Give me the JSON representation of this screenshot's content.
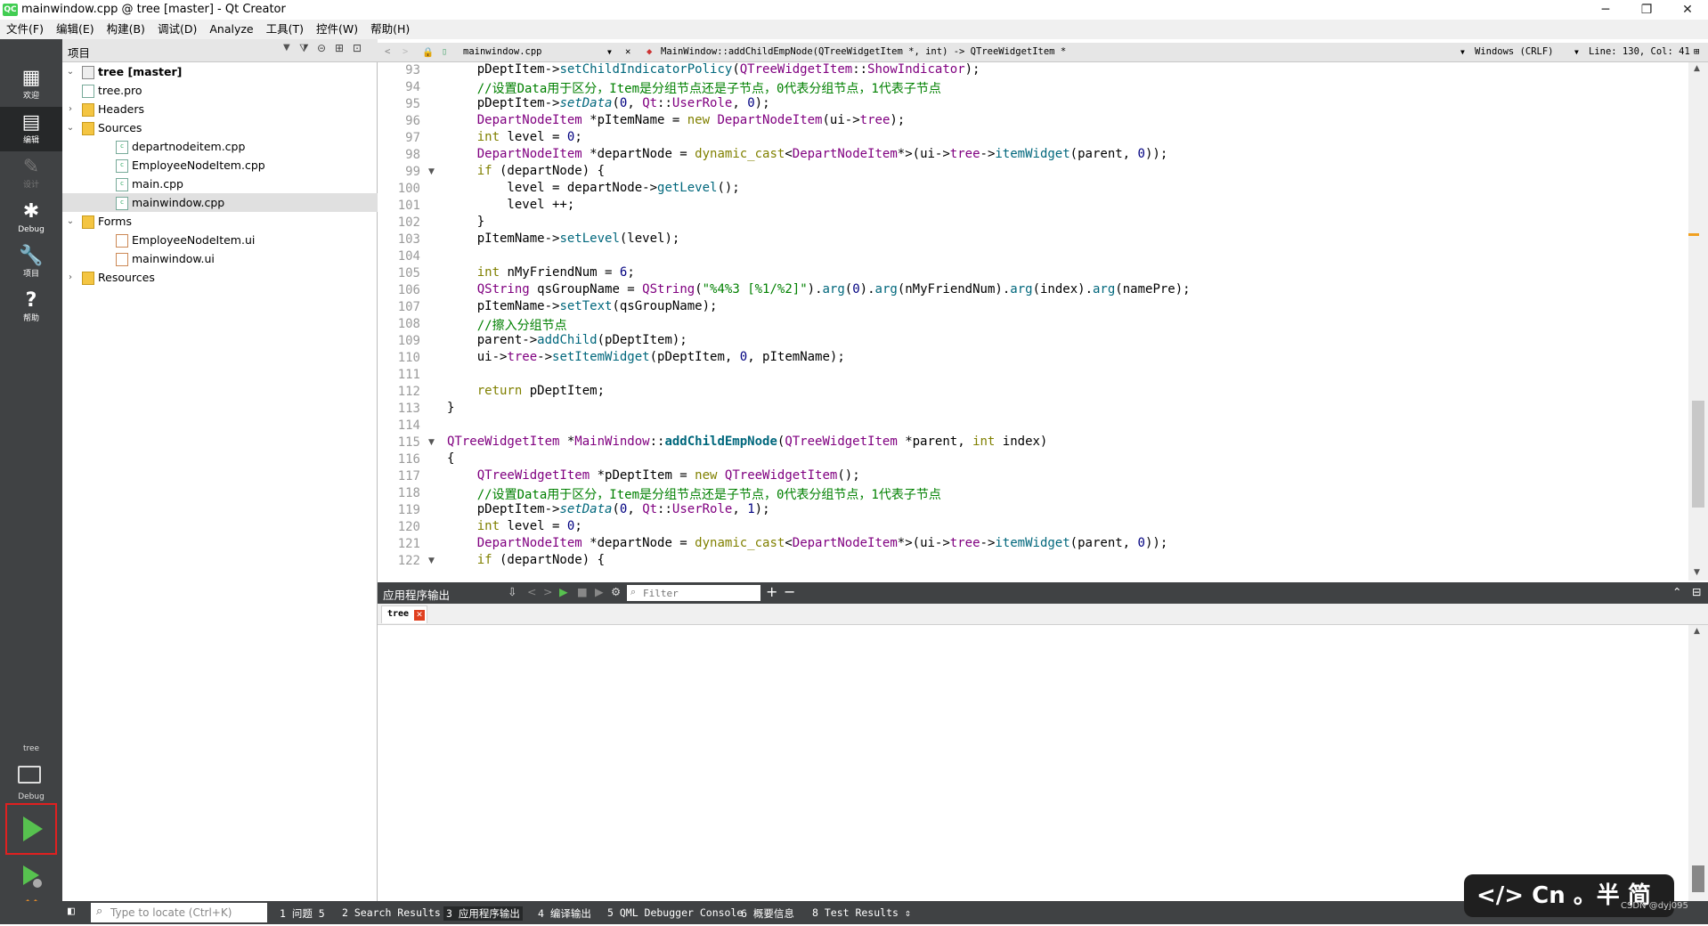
{
  "window": {
    "title": "mainwindow.cpp @ tree [master] - Qt Creator",
    "logo": "QC"
  },
  "window_buttons": {
    "minimize": "─",
    "maximize": "❐",
    "close": "✕"
  },
  "menu": [
    "文件(F)",
    "编辑(E)",
    "构建(B)",
    "调试(D)",
    "Analyze",
    "工具(T)",
    "控件(W)",
    "帮助(H)"
  ],
  "modes": [
    {
      "label": "欢迎",
      "icon": "▦"
    },
    {
      "label": "编辑",
      "icon": "▤"
    },
    {
      "label": "设计",
      "icon": "✎"
    },
    {
      "label": "Debug",
      "icon": "✱"
    },
    {
      "label": "项目",
      "icon": "🔧"
    },
    {
      "label": "帮助",
      "icon": "?"
    }
  ],
  "kit": {
    "project": "tree",
    "config": "Debug"
  },
  "project_panel": {
    "title": "项目"
  },
  "tree": [
    {
      "label": "tree [master]",
      "arrow": "⌄",
      "icon": "proj"
    },
    {
      "label": "tree.pro",
      "icon": "file"
    },
    {
      "label": "Headers",
      "arrow": "›",
      "icon": "folder"
    },
    {
      "label": "Sources",
      "arrow": "⌄",
      "icon": "folder"
    },
    {
      "label": "departnodeitem.cpp",
      "icon": "cpp"
    },
    {
      "label": "EmployeeNodeItem.cpp",
      "icon": "cpp"
    },
    {
      "label": "main.cpp",
      "icon": "cpp"
    },
    {
      "label": "mainwindow.cpp",
      "icon": "cpp",
      "selected": true
    },
    {
      "label": "Forms",
      "arrow": "⌄",
      "icon": "folder"
    },
    {
      "label": "EmployeeNodeItem.ui",
      "icon": "ui"
    },
    {
      "label": "mainwindow.ui",
      "icon": "ui"
    },
    {
      "label": "Resources",
      "arrow": "›",
      "icon": "folder"
    }
  ],
  "editor": {
    "file_tab": "mainwindow.cpp",
    "function": "MainWindow::addChildEmpNode(QTreeWidgetItem *, int) -> QTreeWidgetItem *",
    "encoding": "Windows (CRLF)",
    "position": "Line: 130, Col: 41"
  },
  "code": [
    {
      "n": "93",
      "html": "    pDeptItem-><span class=\"fn\">setChildIndicatorPolicy</span>(<span class=\"ty\">QTreeWidgetItem</span>::<span class=\"ty\">ShowIndicator</span>);"
    },
    {
      "n": "94",
      "html": "    <span class=\"cm\">//设置Data用于区分，Item是分组节点还是子节点，0代表分组节点，1代表子节点</span>"
    },
    {
      "n": "95",
      "html": "    pDeptItem-><span class=\"fn it\">setData</span>(<span class=\"nm\">0</span>, <span class=\"ty\">Qt</span>::<span class=\"ty\">UserRole</span>, <span class=\"nm\">0</span>);"
    },
    {
      "n": "96",
      "html": "    <span class=\"ty\">DepartNodeItem</span> *pItemName = <span class=\"kw\">new</span> <span class=\"ty\">DepartNodeItem</span>(ui-><span class=\"ty\">tree</span>);"
    },
    {
      "n": "97",
      "html": "    <span class=\"kw\">int</span> level = <span class=\"nm\">0</span>;"
    },
    {
      "n": "98",
      "html": "    <span class=\"ty\">DepartNodeItem</span> *departNode = <span class=\"kw\">dynamic_cast</span>&lt;<span class=\"ty\">DepartNodeItem</span>*&gt;(ui-><span class=\"ty\">tree</span>-><span class=\"fn\">itemWidget</span>(parent, <span class=\"nm\">0</span>));"
    },
    {
      "n": "99",
      "fold": true,
      "html": "    <span class=\"kw\">if</span> (departNode) {"
    },
    {
      "n": "100",
      "html": "        level = departNode-><span class=\"fn\">getLevel</span>();"
    },
    {
      "n": "101",
      "html": "        level ++;"
    },
    {
      "n": "102",
      "html": "    }"
    },
    {
      "n": "103",
      "html": "    pItemName-><span class=\"fn\">setLevel</span>(level);"
    },
    {
      "n": "104",
      "html": ""
    },
    {
      "n": "105",
      "html": "    <span class=\"kw\">int</span> nMyFriendNum = <span class=\"nm\">6</span>;"
    },
    {
      "n": "106",
      "html": "    <span class=\"ty\">QString</span> qsGroupName = <span class=\"ty\">QString</span>(<span class=\"st\">\"%4%3 [%1/%2]\"</span>).<span class=\"fn\">arg</span>(<span class=\"nm\">0</span>).<span class=\"fn\">arg</span>(nMyFriendNum).<span class=\"fn\">arg</span>(index).<span class=\"fn\">arg</span>(namePre);"
    },
    {
      "n": "107",
      "html": "    pItemName-><span class=\"fn\">setText</span>(qsGroupName);"
    },
    {
      "n": "108",
      "html": "    <span class=\"cm\">//擦入分组节点</span>"
    },
    {
      "n": "109",
      "html": "    parent-><span class=\"fn\">addChild</span>(pDeptItem);"
    },
    {
      "n": "110",
      "html": "    ui-><span class=\"ty\">tree</span>-><span class=\"fn\">setItemWidget</span>(pDeptItem, <span class=\"nm\">0</span>, pItemName);"
    },
    {
      "n": "111",
      "html": ""
    },
    {
      "n": "112",
      "html": "    <span class=\"kw\">return</span> pDeptItem;"
    },
    {
      "n": "113",
      "html": "}"
    },
    {
      "n": "114",
      "html": ""
    },
    {
      "n": "115",
      "fold": true,
      "html": "<span class=\"ty\">QTreeWidgetItem</span> *<span class=\"ty\">MainWindow</span>::<span class=\"fnd\">addChildEmpNode</span>(<span class=\"ty\">QTreeWidgetItem</span> *parent, <span class=\"kw\">int</span> index)"
    },
    {
      "n": "116",
      "html": "{"
    },
    {
      "n": "117",
      "html": "    <span class=\"ty\">QTreeWidgetItem</span> *pDeptItem = <span class=\"kw\">new</span> <span class=\"ty\">QTreeWidgetItem</span>();"
    },
    {
      "n": "118",
      "html": "    <span class=\"cm\">//设置Data用于区分，Item是分组节点还是子节点，0代表分组节点，1代表子节点</span>"
    },
    {
      "n": "119",
      "html": "    pDeptItem-><span class=\"fn it\">setData</span>(<span class=\"nm\">0</span>, <span class=\"ty\">Qt</span>::<span class=\"ty\">UserRole</span>, <span class=\"nm\">1</span>);"
    },
    {
      "n": "120",
      "html": "    <span class=\"kw\">int</span> level = <span class=\"nm\">0</span>;"
    },
    {
      "n": "121",
      "html": "    <span class=\"ty\">DepartNodeItem</span> *departNode = <span class=\"kw\">dynamic_cast</span>&lt;<span class=\"ty\">DepartNodeItem</span>*&gt;(ui-><span class=\"ty\">tree</span>-><span class=\"fn\">itemWidget</span>(parent, <span class=\"nm\">0</span>));"
    },
    {
      "n": "122",
      "fold": true,
      "html": "    <span class=\"kw\">if</span> (departNode) {"
    }
  ],
  "output": {
    "title": "应用程序输出",
    "filter_placeholder": "Filter",
    "tab": "tree"
  },
  "status": {
    "locate_placeholder": "Type to locate (Ctrl+K)",
    "items": [
      "1 问题 5",
      "2 Search Results",
      "3 应用程序输出",
      "4 编译输出",
      "5 QML Debugger Console",
      "6 概要信息",
      "8 Test Results"
    ]
  },
  "ime": {
    "text": "</> Cn 。半 简"
  },
  "watermark": "CSDN @dyj095"
}
